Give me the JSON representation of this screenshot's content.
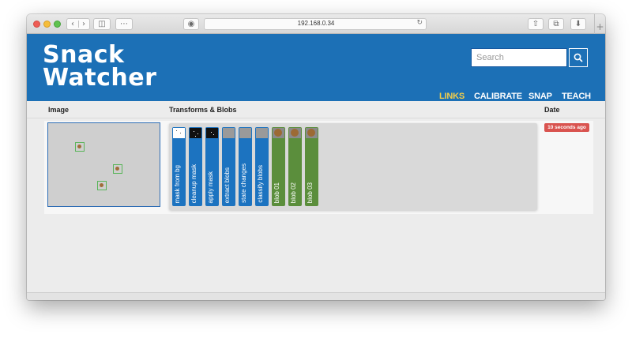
{
  "browser": {
    "address": "192.168.0.34",
    "icons": [
      "back-icon",
      "forward-icon",
      "sidebar-icon",
      "grid-icon",
      "privacy-icon",
      "reload-icon",
      "share-icon",
      "tabs-icon",
      "download-icon",
      "new-tab-icon"
    ]
  },
  "brand": {
    "line1": "Snack",
    "line2": "Watcher"
  },
  "search": {
    "placeholder": "Search"
  },
  "nav": [
    {
      "label": "LINKS",
      "active": true
    },
    {
      "label": "CALIBRATE",
      "active": false
    },
    {
      "label": "SNAP",
      "active": false
    },
    {
      "label": "TEACH",
      "active": false
    }
  ],
  "colors": {
    "header": "#1c70b6",
    "nav_active": "#f2cd4a",
    "transform_card": "#1c73c0",
    "blob_card": "#5b8e3c",
    "date_badge": "#d9534f"
  },
  "table": {
    "headers": {
      "image": "Image",
      "transforms": "Transforms & Blobs",
      "date": "Date"
    },
    "rows": [
      {
        "transforms": [
          "mask from bg",
          "cleanup mask",
          "apply mask",
          "extract blobs",
          "state changes",
          "classify blobs"
        ],
        "blobs": [
          "blob 01",
          "blob 02",
          "blob 03"
        ],
        "date": "10 seconds ago"
      }
    ]
  }
}
